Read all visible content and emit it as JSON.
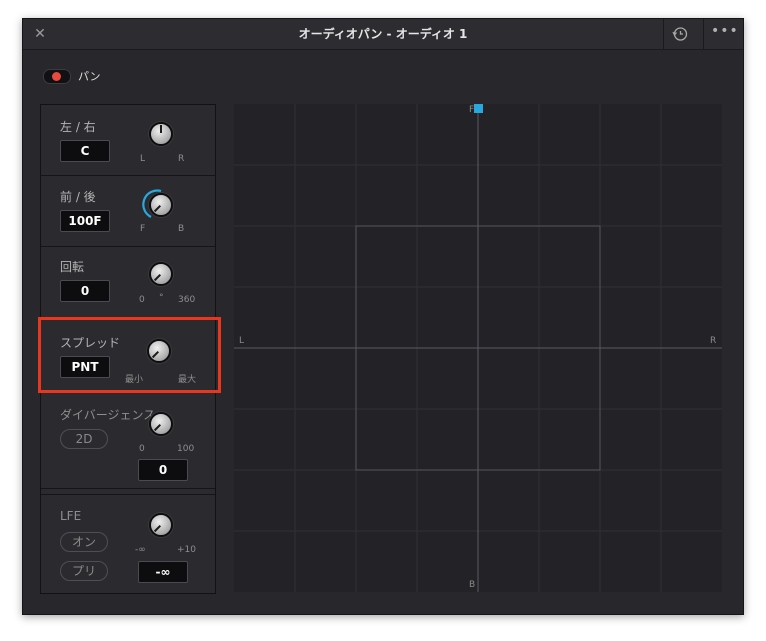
{
  "window": {
    "title": "オーディオパン - オーディオ 1"
  },
  "titlebar": {
    "close_icon": "close-icon",
    "history_icon": "history-icon",
    "more_icon": "more-icon",
    "more_glyph": "•••"
  },
  "pan_toggle": {
    "label": "パン",
    "state": "on",
    "color": "#e84a3d"
  },
  "sections": {
    "left_right": {
      "label": "左 / 右",
      "value": "C",
      "min_label": "L",
      "max_label": "R"
    },
    "front_back": {
      "label": "前 / 後",
      "value": "100F",
      "min_label": "F",
      "max_label": "B"
    },
    "rotation": {
      "label": "回転",
      "value": "0",
      "min_label": "0",
      "mid_label": "°",
      "max_label": "360"
    },
    "spread": {
      "label": "スプレッド",
      "value": "PNT",
      "min_label": "最小",
      "max_label": "最大"
    },
    "divergence": {
      "label": "ダイバージェンス",
      "mode_button": "2D",
      "min_label": "0",
      "max_label": "100",
      "value": "0"
    },
    "lfe": {
      "label": "LFE",
      "on_button": "オン",
      "pre_button": "プリ",
      "min_label": "-∞",
      "max_label": "+10",
      "value": "-∞"
    }
  },
  "pan_grid": {
    "front_label": "F",
    "back_label": "B",
    "left_label": "L",
    "right_label": "R",
    "puck_color": "#29a8e0",
    "puck_position": {
      "x": 0,
      "y": 1.0
    }
  },
  "colors": {
    "accent_blue": "#29a8e0",
    "highlight_red": "#e8361f",
    "toggle_red": "#e84a3d"
  }
}
